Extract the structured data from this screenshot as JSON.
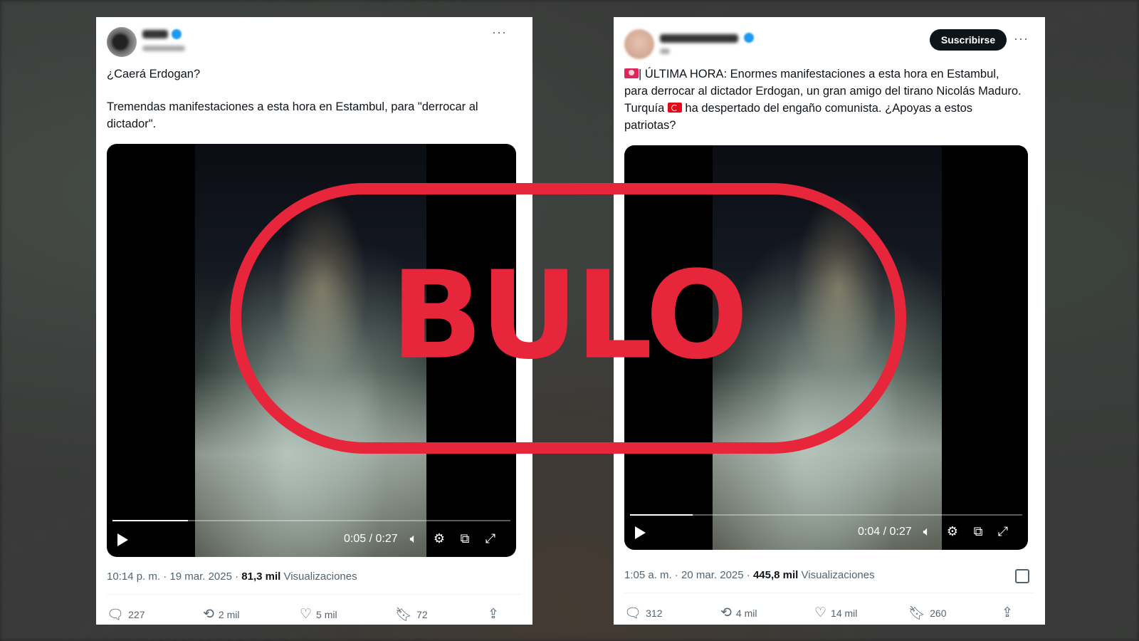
{
  "left_tweet": {
    "question": "¿Caerá Erdogan?",
    "body": "Tremendas manifestaciones a esta hora en Estambul, para \"derrocar al dictador\".",
    "video_time": "0:05 / 0:27",
    "video_progress": 0.19,
    "timestamp": "10:14 p. m. · 19 mar. 2025 · ",
    "views_count": "81,3 mil",
    "views_label": "Visualizaciones",
    "replies": "227",
    "reposts": "2 mil",
    "likes": "5 mil",
    "bookmarks": "72"
  },
  "right_tweet": {
    "subscribe_label": "Suscribirse",
    "body_part1": "| ÚLTIMA HORA: Enormes manifestaciones a esta hora en Estambul, para derrocar al dictador Erdogan, un gran amigo del tirano Nicolás Maduro. Turquía ",
    "body_part2": " ha despertado del engaño comunista. ¿Apoyas a estos patriotas?",
    "video_time": "0:04 / 0:27",
    "video_progress": 0.16,
    "timestamp": "1:05 a. m. · 20 mar. 2025 · ",
    "views_count": "445,8 mil",
    "views_label": "Visualizaciones",
    "replies": "312",
    "reposts": "4 mil",
    "likes": "14 mil",
    "bookmarks": "260"
  },
  "stamp": {
    "text": "BULO",
    "color": "#e8263b"
  },
  "icons": {
    "reply": "reply-icon",
    "repost": "repost-icon",
    "like": "heart-icon",
    "bookmark": "bookmark-icon",
    "share": "share-icon",
    "play": "play-icon",
    "volume": "volume-icon",
    "settings": "gear-icon",
    "pip": "pip-icon",
    "fullscreen": "fullscreen-icon"
  }
}
